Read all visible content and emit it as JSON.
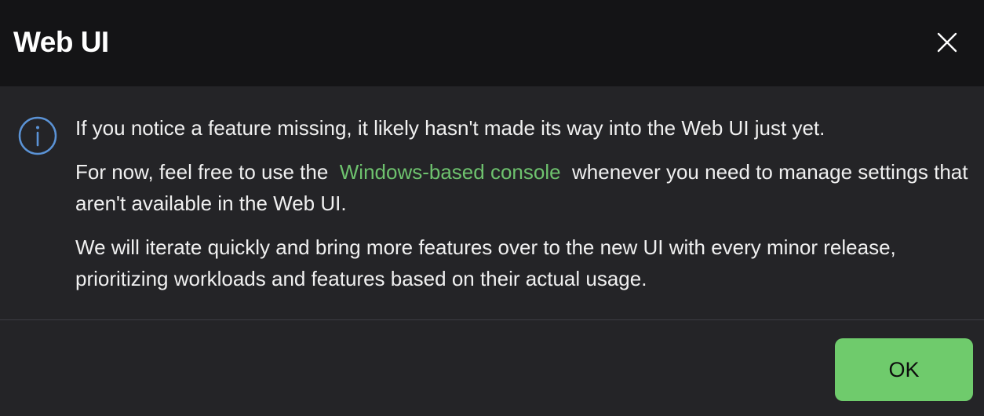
{
  "dialog": {
    "title": "Web UI",
    "close_icon": "close-icon",
    "info_icon": "info-icon",
    "message": {
      "line1": "If you notice a feature missing, it likely hasn't made its way into the Web UI just yet.",
      "line2_before": "For now, feel free to use the",
      "line2_link": "Windows-based console",
      "line2_after": "whenever you need to manage settings that aren't available in the Web UI.",
      "line3": "We will iterate quickly and bring more features over to the new UI with every minor release, prioritizing workloads and features based on their actual usage."
    },
    "ok_label": "OK"
  },
  "colors": {
    "header_bg": "#141416",
    "body_bg": "#242427",
    "link": "#6ec26e",
    "ok_button": "#6fcb6c",
    "info_icon": "#5b93d6"
  }
}
